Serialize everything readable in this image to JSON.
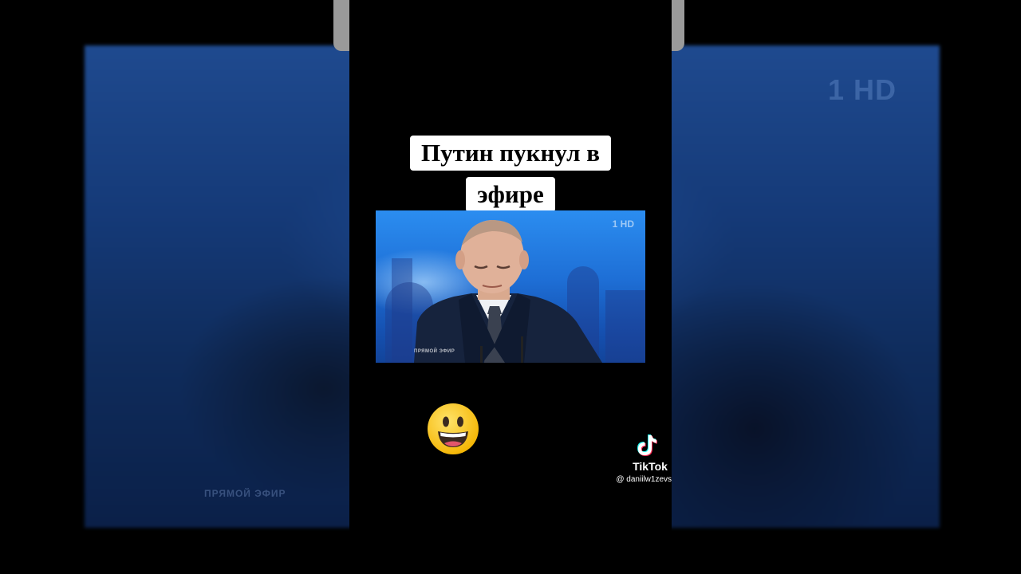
{
  "caption": {
    "line1": "Путин пукнул в",
    "line2": "эфире"
  },
  "video": {
    "channel_logo": "1 HD",
    "live_label": "ПРЯМОЙ ЭФИР"
  },
  "background": {
    "channel_logo": "1 HD",
    "live_label": "ПРЯМОЙ ЭФИР"
  },
  "sticker": {
    "emoji": "grinning-face-emoji"
  },
  "watermark": {
    "brand": "TikTok",
    "username": "@ daniilw1zevs",
    "icon": "tiktok-logo-icon"
  }
}
